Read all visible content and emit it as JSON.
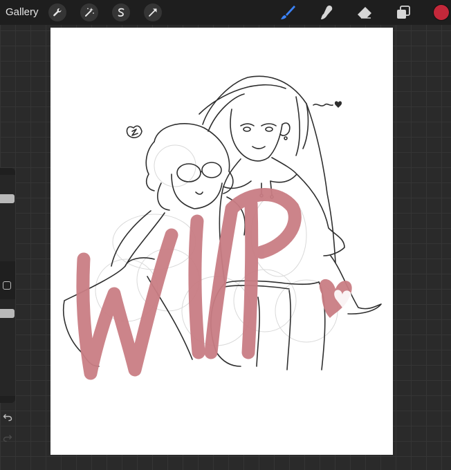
{
  "toolbar": {
    "gallery_label": "Gallery",
    "left_tools": [
      "wrench-icon",
      "magic-wand-icon",
      "selection-icon",
      "transform-icon"
    ],
    "right_tools": [
      "brush-icon",
      "smudge-icon",
      "eraser-icon",
      "layers-icon"
    ],
    "active_tool": "brush",
    "accent_color": "#3b82f6",
    "current_color": "#c4283a"
  },
  "sidebar": {
    "brush_size_level": 0.15,
    "opacity_level": 0.4
  },
  "canvas": {
    "background": "#ffffff",
    "overlay_text_color": "#c97d84"
  }
}
